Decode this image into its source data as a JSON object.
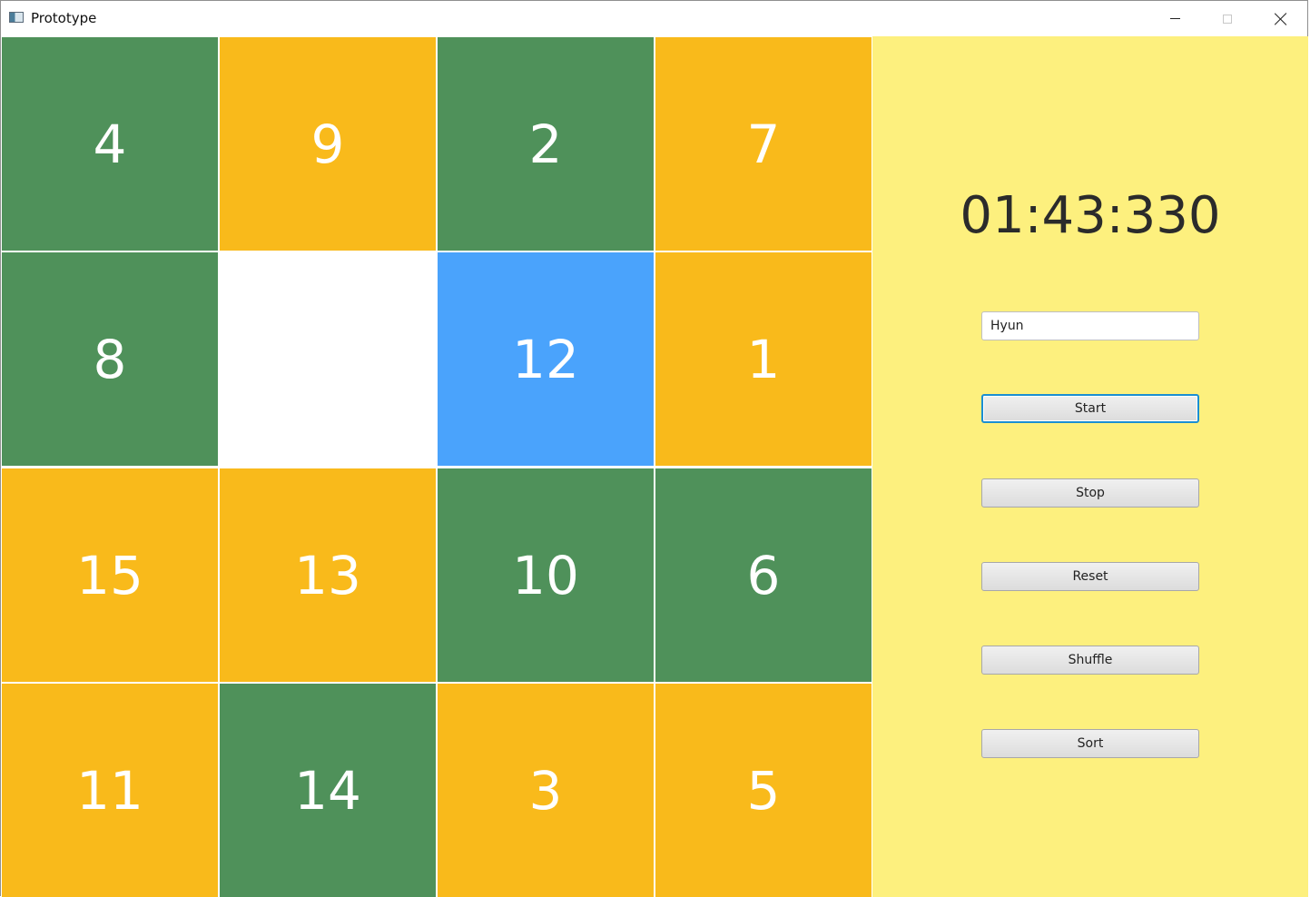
{
  "window": {
    "title": "Prototype",
    "icon": "app-window-icon"
  },
  "board": {
    "rows": [
      [
        {
          "label": "4",
          "color": "green"
        },
        {
          "label": "9",
          "color": "amber"
        },
        {
          "label": "2",
          "color": "green"
        },
        {
          "label": "7",
          "color": "amber"
        }
      ],
      [
        {
          "label": "8",
          "color": "green"
        },
        {
          "label": "",
          "color": "empty"
        },
        {
          "label": "12",
          "color": "blue"
        },
        {
          "label": "1",
          "color": "amber"
        }
      ],
      [
        {
          "label": "15",
          "color": "amber"
        },
        {
          "label": "13",
          "color": "amber"
        },
        {
          "label": "10",
          "color": "green"
        },
        {
          "label": "6",
          "color": "green"
        }
      ],
      [
        {
          "label": "11",
          "color": "amber"
        },
        {
          "label": "14",
          "color": "green"
        },
        {
          "label": "3",
          "color": "amber"
        },
        {
          "label": "5",
          "color": "amber"
        }
      ]
    ]
  },
  "colors": {
    "green": "#4f915a",
    "amber": "#f9ba1b",
    "blue": "#4aa3fc",
    "panel": "#fdf07e"
  },
  "panel": {
    "timer": "01:43:330",
    "name_value": "Hyun",
    "buttons": {
      "start": "Start",
      "stop": "Stop",
      "reset": "Reset",
      "shuffle": "Shuffle",
      "sort": "Sort"
    }
  }
}
